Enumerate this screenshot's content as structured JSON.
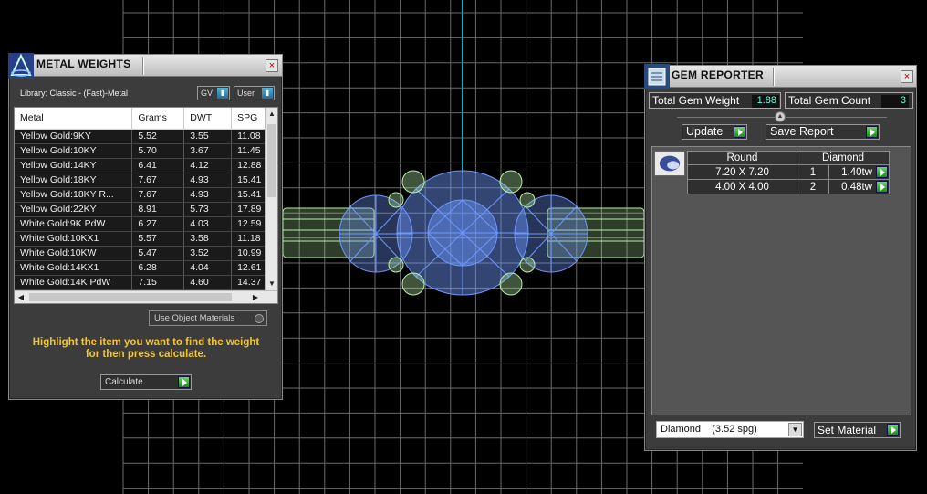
{
  "metal_weights": {
    "title": "METAL WEIGHTS",
    "close": "×",
    "library_label": "Library: Classic - (Fast)-Metal",
    "gv_dropdown": "GV",
    "user_dropdown": "User",
    "columns": [
      "Metal",
      "Grams",
      "DWT",
      "SPG"
    ],
    "rows": [
      [
        "Yellow Gold:9KY",
        "5.52",
        "3.55",
        "11.08"
      ],
      [
        "Yellow Gold:10KY",
        "5.70",
        "3.67",
        "11.45"
      ],
      [
        "Yellow Gold:14KY",
        "6.41",
        "4.12",
        "12.88"
      ],
      [
        "Yellow Gold:18KY",
        "7.67",
        "4.93",
        "15.41"
      ],
      [
        "Yellow Gold:18KY R...",
        "7.67",
        "4.93",
        "15.41"
      ],
      [
        "Yellow Gold:22KY",
        "8.91",
        "5.73",
        "17.89"
      ],
      [
        "White Gold:9K PdW",
        "6.27",
        "4.03",
        "12.59"
      ],
      [
        "White Gold:10KX1",
        "5.57",
        "3.58",
        "11.18"
      ],
      [
        "White Gold:10KW",
        "5.47",
        "3.52",
        "10.99"
      ],
      [
        "White Gold:14KX1",
        "6.28",
        "4.04",
        "12.61"
      ],
      [
        "White Gold:14K PdW",
        "7.15",
        "4.60",
        "14.37"
      ]
    ],
    "use_object_materials": "Use Object Materials",
    "hint_line1": "Highlight the item you want to find the weight",
    "hint_line2": "for then press calculate.",
    "calculate": "Calculate"
  },
  "gem_reporter": {
    "title": "GEM REPORTER",
    "close": "×",
    "total_weight_label": "Total Gem Weight",
    "total_weight_value": "1.88",
    "total_count_label": "Total Gem Count",
    "total_count_value": "3",
    "update_label": "Update",
    "save_report_label": "Save Report",
    "table_header_shape": "Round",
    "table_header_material": "Diamond",
    "rows": [
      {
        "size": "7.20 X 7.20",
        "count": "1",
        "tw": "1.40tw"
      },
      {
        "size": "4.00 X 4.00",
        "count": "2",
        "tw": "0.48tw"
      }
    ],
    "material_select": "Diamond    (3.52 spg)",
    "set_material_label": "Set Material"
  },
  "colors": {
    "grid": "#6a6a6a",
    "wire_blue": "#6f98ff",
    "wire_green": "#b8f0a8",
    "axis_cyan": "#1ea8c8",
    "hint_yellow": "#f3c531"
  }
}
